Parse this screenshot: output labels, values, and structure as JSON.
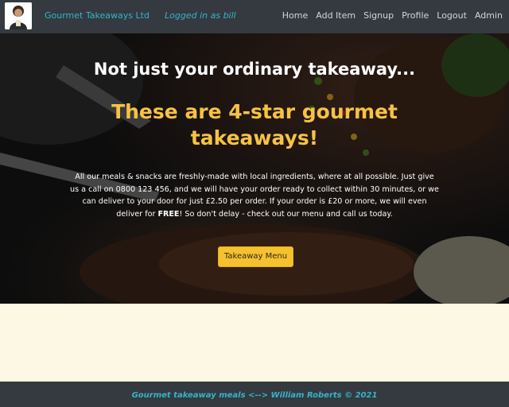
{
  "navbar": {
    "brand": "Gourmet Takeaways Ltd",
    "logged_in": "Logged in as bill",
    "links": [
      "Home",
      "Add Item",
      "Signup",
      "Profile",
      "Logout",
      "Admin"
    ]
  },
  "hero": {
    "tagline": "Not just your ordinary takeaway...",
    "headline": "These are 4-star gourmet takeaways!",
    "blurb_part1": "All our meals & snacks are freshly-made with local ingredients, where at all possible. Just give us a call on 0800 123 456, and we will have your order ready to collect within 30 minutes, or we can deliver to your door for just £2.50 per order. If your order is £20 or more, we will even deliver for ",
    "blurb_bold": "FREE",
    "blurb_part2": "! So don't delay - check out our menu and call us today.",
    "button_label": "Takeaway Menu"
  },
  "footer": {
    "text": "Gourmet takeaway meals <--> William Roberts © 2021"
  },
  "colors": {
    "navbar_bg": "#343a40",
    "brand": "#35b4c9",
    "headline": "#f7c243",
    "button_bg": "#f5c12e",
    "content_bg": "#fdf8e4"
  },
  "icons": [
    "chef-logo-icon"
  ]
}
